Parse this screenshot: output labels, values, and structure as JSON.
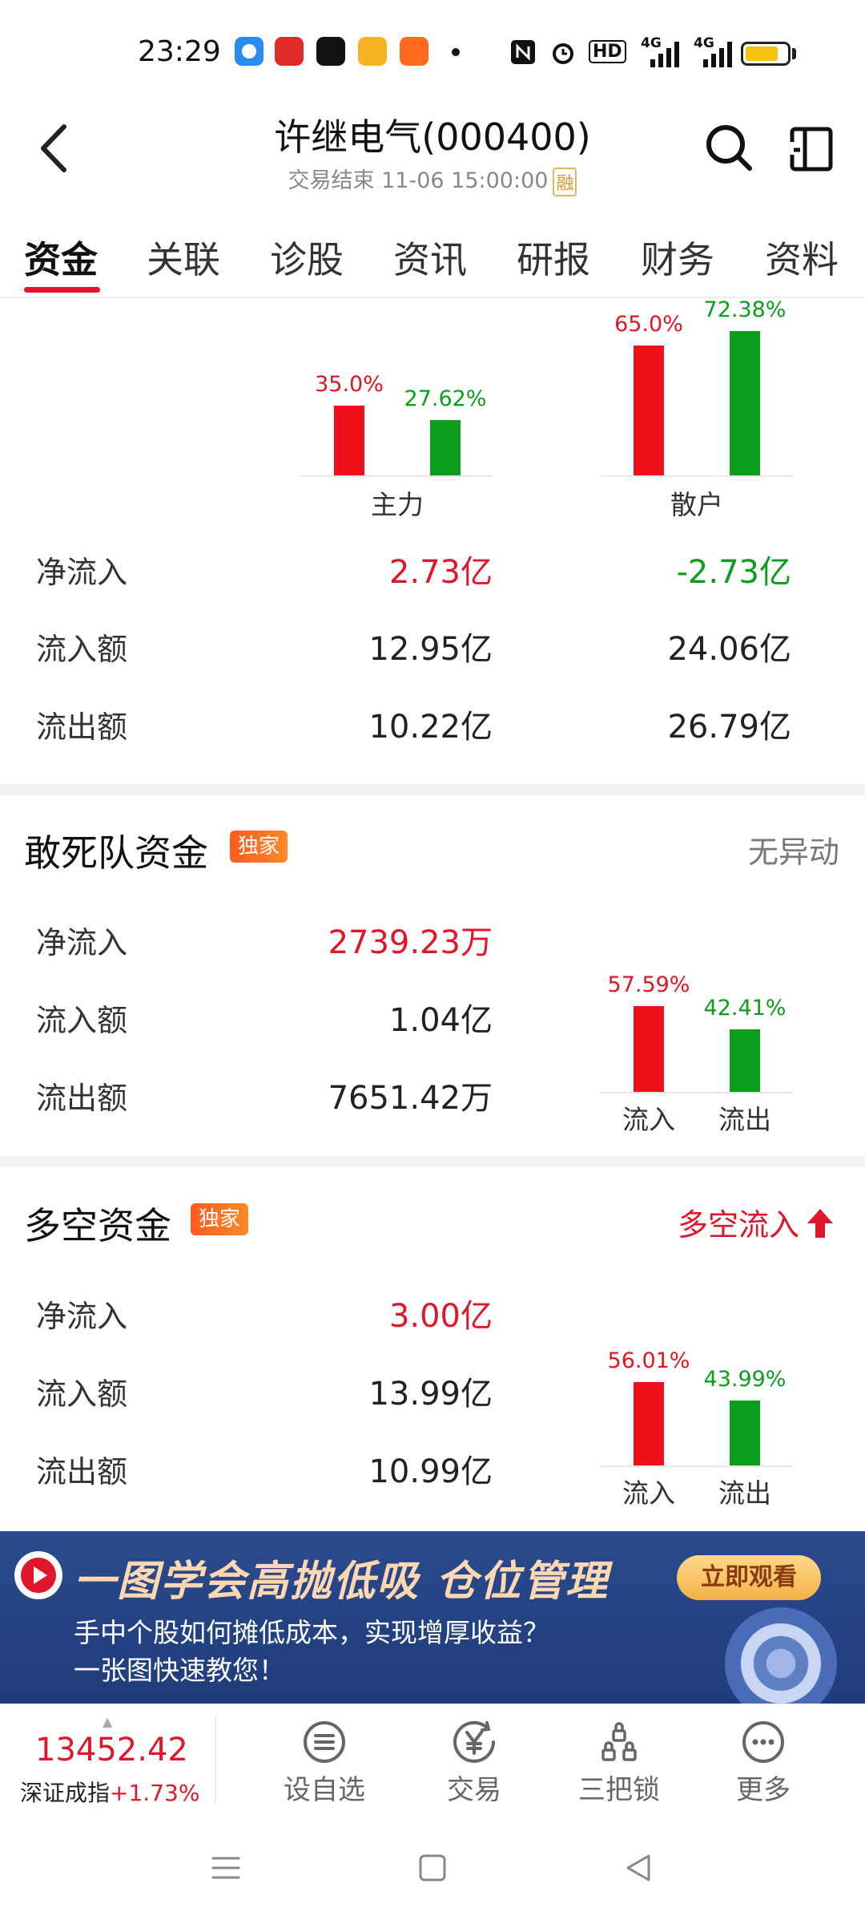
{
  "status_bar": {
    "time": "23:29",
    "icons": [
      "browser-icon",
      "stock-app-icon",
      "tiktok-icon",
      "video-app-icon",
      "kuaishou-icon",
      "dot-icon",
      "nfc-icon",
      "alarm-icon",
      "hd-icon",
      "signal-4g-1-icon",
      "signal-4g-2-icon",
      "battery-icon"
    ],
    "hd_text": "HD",
    "net1": "4G",
    "net2": "4G",
    "battery_level": 0.8
  },
  "header": {
    "title": "许继电气(000400)",
    "subtitle": "交易结束 11-06 15:00:00",
    "badge": "融"
  },
  "tabs": [
    {
      "label": "资金"
    },
    {
      "label": "关联"
    },
    {
      "label": "诊股"
    },
    {
      "label": "资讯"
    },
    {
      "label": "研报"
    },
    {
      "label": "财务"
    },
    {
      "label": "资料"
    }
  ],
  "active_tab": "资金",
  "top_section": {
    "chart_data": {
      "type": "bar",
      "categories": [
        "主力",
        "散户"
      ],
      "series": [
        {
          "values": [
            35.0,
            65.0
          ],
          "labels": [
            "35.0%",
            "65.0%"
          ],
          "color": "#f0101c"
        },
        {
          "values": [
            27.62,
            72.38
          ],
          "labels": [
            "27.62%",
            "72.38%"
          ],
          "color": "#0a9e1c"
        }
      ],
      "ylim": [
        0,
        72.38
      ]
    },
    "rows": [
      {
        "label": "净流入",
        "main": "2.73亿",
        "retail": "-2.73亿"
      },
      {
        "label": "流入额",
        "main": "12.95亿",
        "retail": "24.06亿"
      },
      {
        "label": "流出额",
        "main": "10.22亿",
        "retail": "26.79亿"
      }
    ]
  },
  "dare_section": {
    "title": "敢死队资金",
    "badge": "独家",
    "status": "无异动",
    "rows": [
      {
        "label": "净流入",
        "value": "2739.23万"
      },
      {
        "label": "流入额",
        "value": "1.04亿"
      },
      {
        "label": "流出额",
        "value": "7651.42万"
      }
    ],
    "chart_data": {
      "type": "bar",
      "categories": [
        "流入",
        "流出"
      ],
      "values": [
        57.59,
        42.41
      ],
      "labels": [
        "57.59%",
        "42.41%"
      ],
      "colors": [
        "#f0101c",
        "#0a9e1c"
      ]
    }
  },
  "longshort_section": {
    "title": "多空资金",
    "badge": "独家",
    "status": "多空流入",
    "rows": [
      {
        "label": "净流入",
        "value": "3.00亿"
      },
      {
        "label": "流入额",
        "value": "13.99亿"
      },
      {
        "label": "流出额",
        "value": "10.99亿"
      }
    ],
    "chart_data": {
      "type": "bar",
      "categories": [
        "流入",
        "流出"
      ],
      "values": [
        56.01,
        43.99
      ],
      "labels": [
        "56.01%",
        "43.99%"
      ],
      "colors": [
        "#f0101c",
        "#0a9e1c"
      ]
    }
  },
  "banner": {
    "title": "一图学会高抛低吸 仓位管理",
    "button": "立即观看",
    "line1": "手中个股如何摊低成本，实现增厚收益？",
    "line2": "一张图快速教您！"
  },
  "bottom_bar": {
    "index_value": "13452.42",
    "index_name": "深证成指",
    "index_change": "+1.73%",
    "tools": [
      {
        "label": "设自选",
        "icon": "list-icon"
      },
      {
        "label": "交易",
        "icon": "yen-icon"
      },
      {
        "label": "三把锁",
        "icon": "locks-icon"
      },
      {
        "label": "更多",
        "icon": "more-icon"
      }
    ]
  }
}
